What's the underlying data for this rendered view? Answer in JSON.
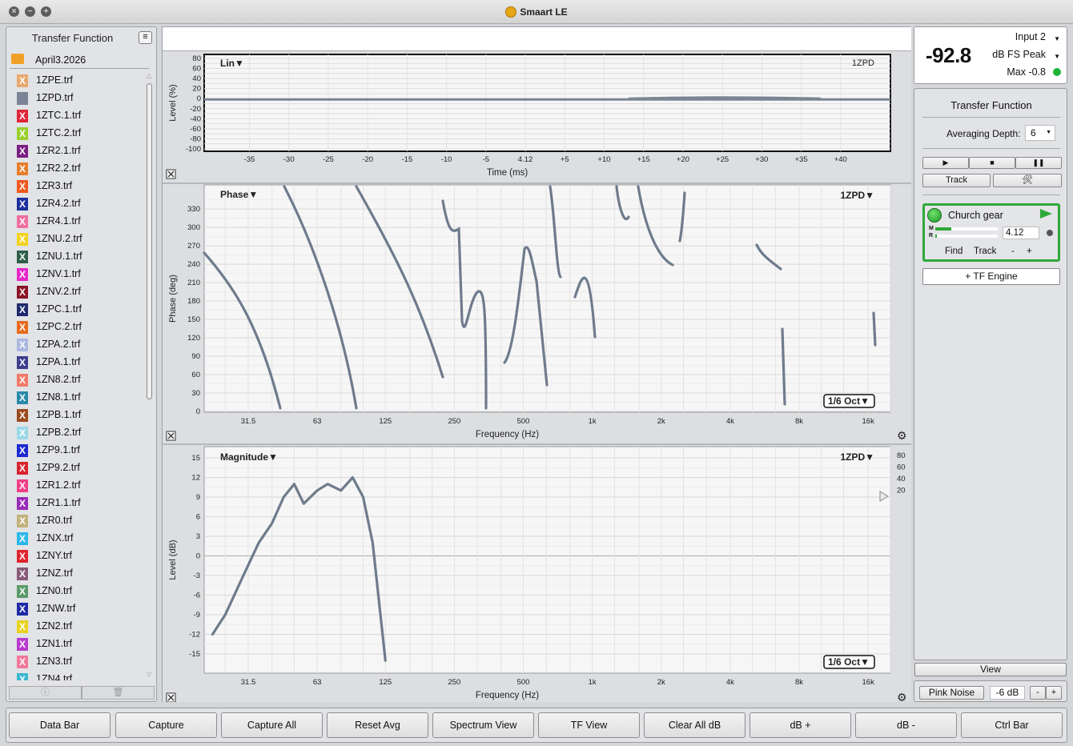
{
  "window": {
    "title": "Smaart LE"
  },
  "file_panel": {
    "title": "Transfer Function",
    "folder": "April3.2026",
    "files": [
      {
        "name": "1ZPE.trf",
        "color": "#e8a96e"
      },
      {
        "name": "1ZPD.trf",
        "color": "#7b8496"
      },
      {
        "name": "1ZTC.1.trf",
        "color": "#e0243a"
      },
      {
        "name": "1ZTC.2.trf",
        "color": "#9ad02e"
      },
      {
        "name": "1ZR2.1.trf",
        "color": "#7a1e82"
      },
      {
        "name": "1ZR2.2.trf",
        "color": "#e67e2a"
      },
      {
        "name": "1ZR3.trf",
        "color": "#f05a1e"
      },
      {
        "name": "1ZR4.2.trf",
        "color": "#1e2fa0"
      },
      {
        "name": "1ZR4.1.trf",
        "color": "#f06fa0"
      },
      {
        "name": "1ZNU.2.trf",
        "color": "#f2d21e"
      },
      {
        "name": "1ZNU.1.trf",
        "color": "#2e5e4a"
      },
      {
        "name": "1ZNV.1.trf",
        "color": "#e628c8"
      },
      {
        "name": "1ZNV.2.trf",
        "color": "#8a1426"
      },
      {
        "name": "1ZPC.1.trf",
        "color": "#1e2a6e"
      },
      {
        "name": "1ZPC.2.trf",
        "color": "#e86a1e"
      },
      {
        "name": "1ZPA.2.trf",
        "color": "#a9b8e0"
      },
      {
        "name": "1ZPA.1.trf",
        "color": "#3e3e8e"
      },
      {
        "name": "1ZN8.2.trf",
        "color": "#f27a6a"
      },
      {
        "name": "1ZN8.1.trf",
        "color": "#2a8aa8"
      },
      {
        "name": "1ZPB.1.trf",
        "color": "#9a4a1e"
      },
      {
        "name": "1ZPB.2.trf",
        "color": "#9ad8e8"
      },
      {
        "name": "1ZP9.1.trf",
        "color": "#1e2ad0"
      },
      {
        "name": "1ZP9.2.trf",
        "color": "#d8242e"
      },
      {
        "name": "1ZR1.2.trf",
        "color": "#f0408a"
      },
      {
        "name": "1ZR1.1.trf",
        "color": "#9a2ab8"
      },
      {
        "name": "1ZR0.trf",
        "color": "#c0b27a"
      },
      {
        "name": "1ZNX.trf",
        "color": "#2ab8e8"
      },
      {
        "name": "1ZNY.trf",
        "color": "#e0242e"
      },
      {
        "name": "1ZNZ.trf",
        "color": "#8a5a7a"
      },
      {
        "name": "1ZN0.trf",
        "color": "#5a9a6a"
      },
      {
        "name": "1ZNW.trf",
        "color": "#1e2aa8"
      },
      {
        "name": "1ZN2.trf",
        "color": "#e8d21e"
      },
      {
        "name": "1ZN1.trf",
        "color": "#b83ad0"
      },
      {
        "name": "1ZN3.trf",
        "color": "#f07a9a"
      },
      {
        "name": "1ZN4.trf",
        "color": "#3ab8d0"
      }
    ]
  },
  "graphs": {
    "lin": {
      "mode": "Lin",
      "trace": "1ZPD",
      "ylabel": "Level (%)",
      "xlabel": "Time (ms)",
      "yticks": [
        "80",
        "60",
        "40",
        "20",
        "0",
        "-20",
        "-40",
        "-60",
        "-80",
        "-100"
      ],
      "xticks": [
        "-35",
        "-30",
        "-25",
        "-20",
        "-15",
        "-10",
        "-5",
        "4.12",
        "+5",
        "+10",
        "+15",
        "+20",
        "+25",
        "+30",
        "+35",
        "+40"
      ]
    },
    "phase": {
      "mode": "Phase",
      "trace": "1ZPD",
      "ylabel": "Phase (deg)",
      "xlabel": "Frequency (Hz)",
      "smoothing": "1/6 Oct",
      "yticks": [
        "330",
        "300",
        "270",
        "240",
        "210",
        "180",
        "150",
        "120",
        "90",
        "60",
        "30",
        "0"
      ],
      "xticks": [
        "31.5",
        "63",
        "125",
        "250",
        "500",
        "1k",
        "2k",
        "4k",
        "8k",
        "16k"
      ]
    },
    "magnitude": {
      "mode": "Magnitude",
      "trace": "1ZPD",
      "ylabel": "Level (dB)",
      "xlabel": "Frequency (Hz)",
      "smoothing": "1/6 Oct",
      "yticks": [
        "15",
        "12",
        "9",
        "6",
        "3",
        "0",
        "-3",
        "-6",
        "-9",
        "-12",
        "-15"
      ],
      "yticks_right": [
        "80",
        "60",
        "40",
        "20"
      ],
      "xticks": [
        "31.5",
        "63",
        "125",
        "250",
        "500",
        "1k",
        "2k",
        "4k",
        "8k",
        "16k"
      ]
    }
  },
  "meter": {
    "value": "-92.8",
    "input": "Input 2",
    "units": "dB FS Peak",
    "max": "Max -0.8",
    "status_color": "#1fb33a"
  },
  "tf_panel": {
    "title": "Transfer Function",
    "averaging_label": "Averaging Depth:",
    "averaging_value": "6",
    "track_label": "Track",
    "engine_name": "Church gear",
    "delay": "4.12",
    "find_label": "Find",
    "track2_label": "Track",
    "minus": "-",
    "plus": "+",
    "add_engine": "+ TF Engine",
    "view": "View",
    "pink_noise": "Pink Noise",
    "pink_level": "-6 dB"
  },
  "bottom_buttons": [
    "Data Bar",
    "Capture",
    "Capture All",
    "Reset Avg",
    "Spectrum View",
    "TF View",
    "Clear All dB",
    "dB +",
    "dB -",
    "Ctrl Bar"
  ],
  "chart_data": [
    {
      "type": "line",
      "title": "",
      "xlabel": "Time (ms)",
      "ylabel": "Level (%)",
      "ylim": [
        -100,
        80
      ],
      "series": [
        {
          "x": [
            -40,
            45
          ],
          "values": [
            0,
            0
          ]
        }
      ]
    },
    {
      "type": "line",
      "title": "",
      "xlabel": "Frequency (Hz)",
      "ylabel": "Phase (deg)",
      "ylim": [
        0,
        360
      ],
      "x_scale": "log"
    },
    {
      "type": "line",
      "title": "",
      "xlabel": "Frequency (Hz)",
      "ylabel": "Level (dB)",
      "ylim": [
        -16,
        16
      ],
      "x_scale": "log",
      "series": [
        {
          "x": [
            22,
            25,
            30,
            35,
            40,
            45,
            50,
            55,
            63,
            70,
            80,
            90,
            100,
            110,
            125
          ],
          "values": [
            -12,
            -9,
            -3,
            2,
            5,
            9,
            11,
            8,
            10,
            11,
            10,
            12,
            9,
            2,
            -16
          ]
        }
      ]
    }
  ]
}
